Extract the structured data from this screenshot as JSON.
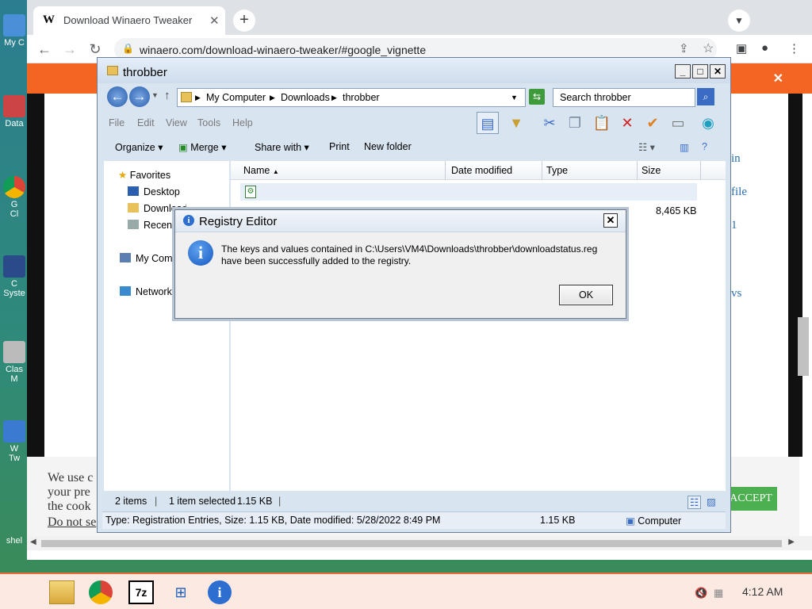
{
  "browser": {
    "tab_title": "Download Winaero Tweaker",
    "tab_favicon": "W",
    "url": "winaero.com/download-winaero-tweaker/#google_vignette"
  },
  "page": {
    "side_links": [
      "in",
      "file",
      "1",
      "vs"
    ],
    "cookie_text": "We use cookies on our website to give you the most relevant experience by remembering your preferences and repeat visits. By clicking Accept, you consent to the use of ALL the cookies.",
    "cookie_lines": [
      "We use c",
      "your pre",
      "the cook"
    ],
    "do_not_sell": "Do not se",
    "accept_label": "ACCEPT"
  },
  "desktop_icons": [
    {
      "label": "My C"
    },
    {
      "label": "Data"
    },
    {
      "label": "G\nCl"
    },
    {
      "label": "C\nSyste"
    },
    {
      "label": "Clas\nM"
    },
    {
      "label": "W\nTw"
    },
    {
      "label": "shel"
    }
  ],
  "explorer": {
    "title": "throbber",
    "breadcrumb": [
      "My Computer",
      "Downloads",
      "throbber"
    ],
    "search_placeholder": "Search throbber",
    "menu": [
      "File",
      "Edit",
      "View",
      "Tools",
      "Help"
    ],
    "commands": [
      "Organize",
      "Merge",
      "Share with",
      "Print",
      "New folder"
    ],
    "nav": {
      "favorites": "Favorites",
      "desktop": "Desktop",
      "downloads": "Downloads",
      "recent": "Recent",
      "my_computer": "My Com",
      "network": "Network"
    },
    "columns": [
      "Name",
      "Date modified",
      "Type",
      "Size"
    ],
    "row2_size": "8,465 KB",
    "status": {
      "items": "2 items",
      "selected": "1 item selected",
      "selected_size": "1.15 KB"
    },
    "details": {
      "info": "Type: Registration Entries, Size: 1.15 KB, Date modified: 5/28/2022 8:49 PM",
      "size": "1.15 KB",
      "location": "Computer"
    }
  },
  "dialog": {
    "title": "Registry Editor",
    "message": "The keys and values contained in C:\\Users\\VM4\\Downloads\\throbber\\downloadstatus.reg have been successfully added to the registry.",
    "ok_label": "OK"
  },
  "taskbar": {
    "clock": "4:12 AM",
    "apps": [
      "explorer-icon",
      "chrome-icon",
      "7zip-icon",
      "windows-icon",
      "info-icon"
    ]
  },
  "colors": {
    "banner": "#f26522",
    "accept": "#4caf50",
    "link": "#2a6fb1"
  }
}
